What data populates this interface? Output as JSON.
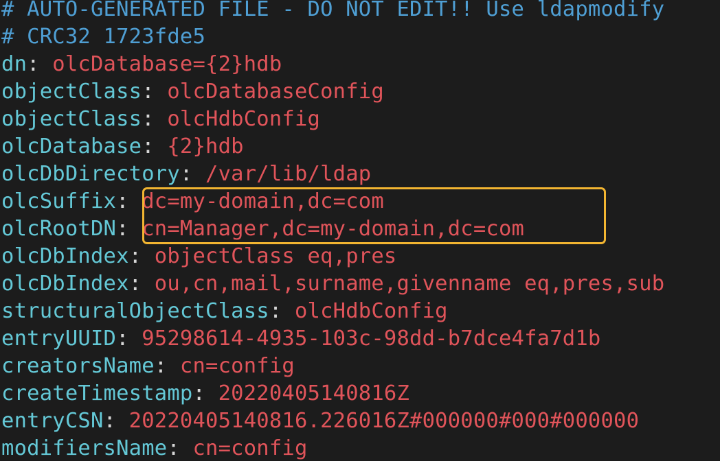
{
  "header": {
    "line1": "# AUTO-GENERATED FILE - DO NOT EDIT!! Use ldapmodify",
    "line2": "# CRC32 1723fde5"
  },
  "entries": [
    {
      "key": "dn",
      "value": "olcDatabase={2}hdb"
    },
    {
      "key": "objectClass",
      "value": "olcDatabaseConfig"
    },
    {
      "key": "objectClass",
      "value": "olcHdbConfig"
    },
    {
      "key": "olcDatabase",
      "value": "{2}hdb"
    },
    {
      "key": "olcDbDirectory",
      "value": "/var/lib/ldap"
    },
    {
      "key": "olcSuffix",
      "value": "dc=my-domain,dc=com"
    },
    {
      "key": "olcRootDN",
      "value": "cn=Manager,dc=my-domain,dc=com"
    },
    {
      "key": "olcDbIndex",
      "value": "objectClass eq,pres"
    },
    {
      "key": "olcDbIndex",
      "value": "ou,cn,mail,surname,givenname eq,pres,sub"
    },
    {
      "key": "structuralObjectClass",
      "value": "olcHdbConfig"
    },
    {
      "key": "entryUUID",
      "value": "95298614-4935-103c-98dd-b7dce4fa7d1b"
    },
    {
      "key": "creatorsName",
      "value": "cn=config"
    },
    {
      "key": "createTimestamp",
      "value": "20220405140816Z"
    },
    {
      "key": "entryCSN",
      "value": "20220405140816.226016Z#000000#000#000000"
    },
    {
      "key": "modifiersName",
      "value": "cn=config"
    }
  ],
  "separator": ": ",
  "highlight_color": "#f2b531",
  "colors": {
    "background": "#1c1c1c",
    "comment": "#4f9fd4",
    "key": "#64c8d6",
    "value": "#e0545a"
  }
}
